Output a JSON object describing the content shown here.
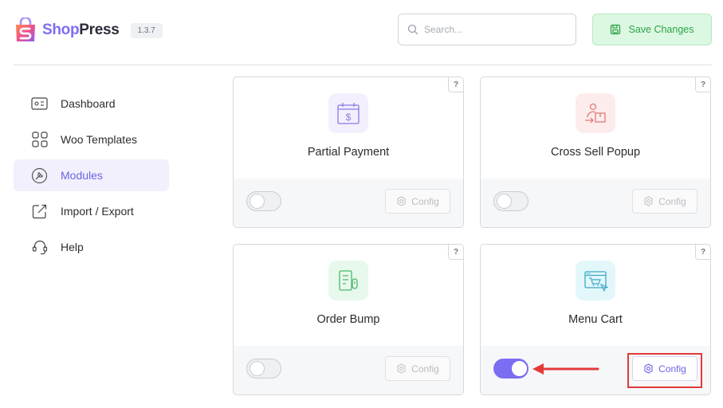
{
  "header": {
    "logo_shop": "Shop",
    "logo_press": "Press",
    "version": "1.3.7",
    "search_placeholder": "Search...",
    "save_label": "Save Changes"
  },
  "sidebar": {
    "items": [
      {
        "label": "Dashboard",
        "icon": "dashboard-icon",
        "active": false
      },
      {
        "label": "Woo Templates",
        "icon": "templates-grid-icon",
        "active": false
      },
      {
        "label": "Modules",
        "icon": "modules-icon",
        "active": true
      },
      {
        "label": "Import / Export",
        "icon": "import-export-icon",
        "active": false
      },
      {
        "label": "Help",
        "icon": "headset-icon",
        "active": false
      }
    ]
  },
  "modules": [
    {
      "title": "Partial Payment",
      "icon": "partial-payment-icon",
      "enabled": false,
      "config_label": "Config",
      "help": "?"
    },
    {
      "title": "Cross Sell Popup",
      "icon": "cross-sell-icon",
      "enabled": false,
      "config_label": "Config",
      "help": "?"
    },
    {
      "title": "Order Bump",
      "icon": "order-bump-icon",
      "enabled": false,
      "config_label": "Config",
      "help": "?"
    },
    {
      "title": "Menu Cart",
      "icon": "menu-cart-icon",
      "enabled": true,
      "config_label": "Config",
      "help": "?"
    }
  ],
  "colors": {
    "accent": "#7b6ef2",
    "save_bg": "#dcf8e2",
    "save_text": "#2fa24a",
    "highlight": "#e33a3a"
  }
}
